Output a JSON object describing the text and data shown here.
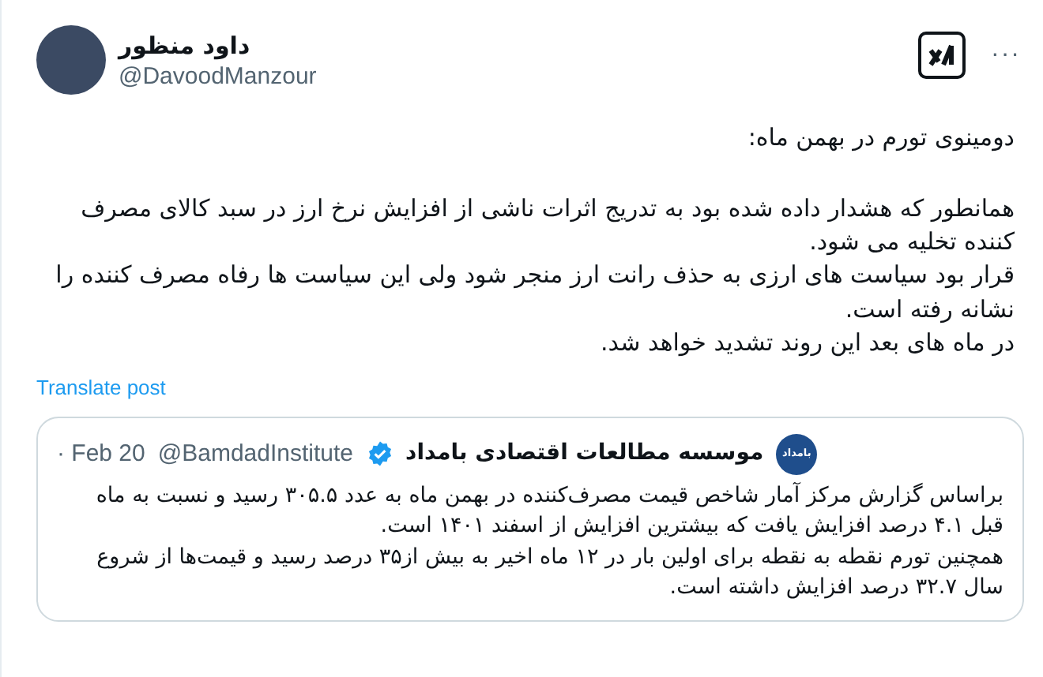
{
  "author": {
    "name": "داود منظور",
    "handle": "@DavoodManzour"
  },
  "menu": "···",
  "post": {
    "paragraphs": [
      "دومینوی تورم در بهمن ماه:",
      "همانطور که هشدار داده شده بود به تدریج اثرات ناشی از افزایش نرخ ارز در سبد کالای مصرف کننده تخلیه می شود.\nقرار بود سیاست های ارزی به حذف رانت ارز منجر شود ولی این سیاست ها رفاه مصرف کننده را نشانه رفته است.\nدر ماه های بعد این روند تشدید خواهد شد."
    ]
  },
  "translate": "Translate post",
  "quote": {
    "logo_text": "بامداد",
    "name": "موسسه مطالعات اقتصادی بامداد",
    "verified": true,
    "handle": "@BamdadInstitute",
    "date": "· Feb 20",
    "text": "براساس گزارش مرکز آمار شاخص قیمت مصرف‌کننده در بهمن ماه به عدد ۳۰۵.۵ رسید و نسبت به ماه قبل ۴.۱ درصد افزایش یافت که بیشترین افزایش از اسفند ۱۴۰۱ است.\nهمچنین تورم نقطه به نقطه برای اولین بار در ۱۲ ماه اخیر به بیش از۳۵ درصد رسید و قیمت‌ها از شروع سال ۳۲.۷ درصد افزایش داشته است."
  }
}
